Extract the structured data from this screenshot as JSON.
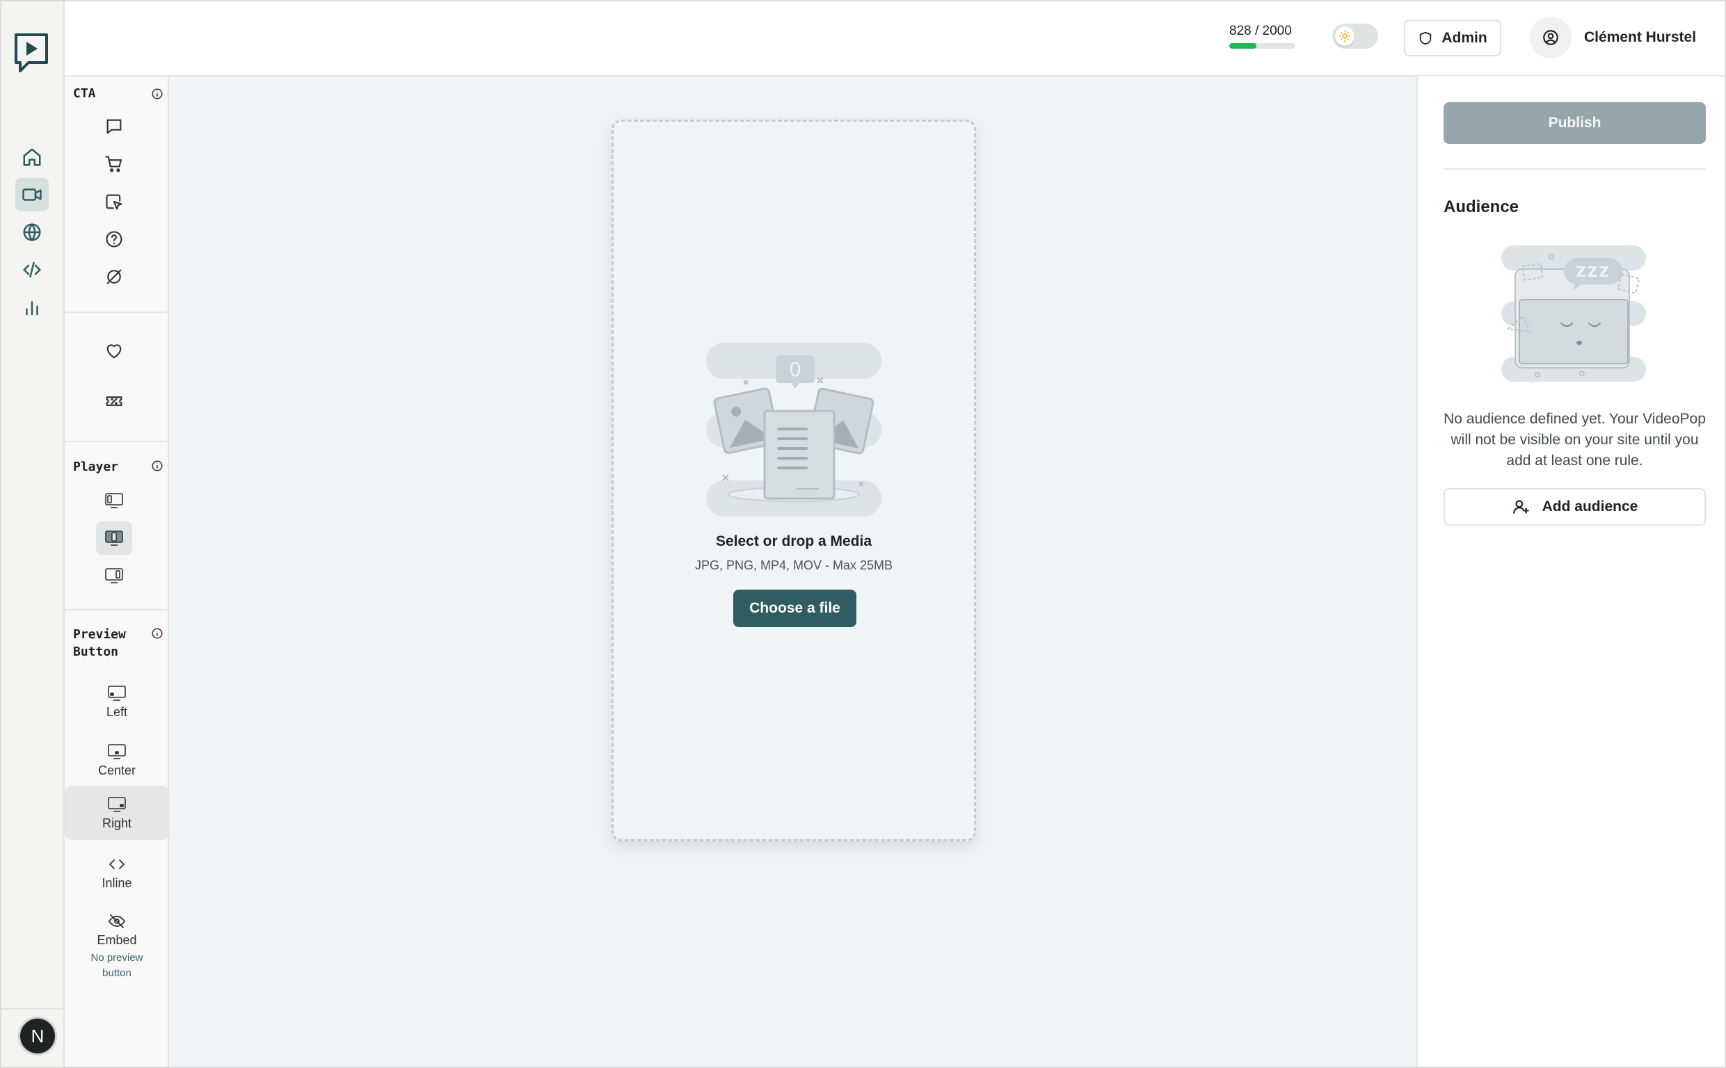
{
  "app": {
    "usage": {
      "used": 828,
      "limit": 2000,
      "label": "828 / 2000",
      "fraction": 0.414
    },
    "theme_toggle": {
      "state": "light"
    },
    "admin_label": "Admin",
    "user_name": "Clément Hurstel",
    "accent_color": "#2f5d62",
    "progress_color": "#1db954"
  },
  "rail": {
    "items": [
      {
        "icon": "home-icon"
      },
      {
        "icon": "video-icon",
        "active": true
      },
      {
        "icon": "globe-icon"
      },
      {
        "icon": "code-icon"
      },
      {
        "icon": "bar-chart-icon"
      }
    ],
    "avatar_letter": "N"
  },
  "tools": {
    "cta": {
      "title": "CTA",
      "items": [
        "message-icon",
        "cart-icon",
        "cursor-click-icon",
        "help-circle-icon",
        "none-icon",
        "heart-icon",
        "ticket-percent-icon"
      ]
    },
    "player": {
      "title": "Player",
      "items": [
        "player-left-icon",
        "player-center-icon",
        "player-right-icon"
      ],
      "active_index": 1
    },
    "preview_button": {
      "title_line1": "Preview",
      "title_line2": "Button",
      "options": [
        {
          "label": "Left"
        },
        {
          "label": "Center"
        },
        {
          "label": "Right",
          "active": true
        },
        {
          "label": "Inline"
        },
        {
          "label": "Embed",
          "sub_line1": "No preview",
          "sub_line2": "button"
        }
      ]
    }
  },
  "dropzone": {
    "badge_count": "0",
    "title": "Select or drop a Media",
    "hint": "JPG, PNG, MP4, MOV - Max 25MB",
    "button_label": "Choose a file"
  },
  "right_panel": {
    "publish_label": "Publish",
    "audience_title": "Audience",
    "illustration_text": "ZZZ",
    "empty_text": "No audience defined yet. Your VideoPop will not be visible on your site until you add at least one rule.",
    "add_label": "Add audience"
  }
}
